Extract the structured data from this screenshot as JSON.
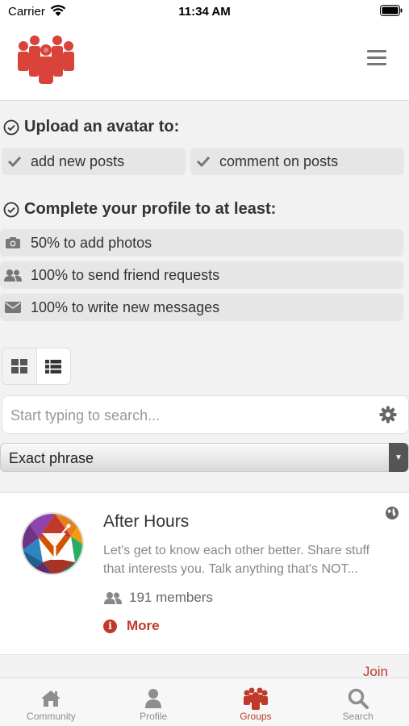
{
  "status_bar": {
    "carrier": "Carrier",
    "time": "11:34 AM"
  },
  "requirements": {
    "avatar_title": "Upload an avatar to:",
    "avatar_items": [
      {
        "label": "add new posts",
        "icon": "check-icon"
      },
      {
        "label": "comment on posts",
        "icon": "check-icon"
      }
    ],
    "profile_title": "Complete your profile to at least:",
    "profile_items": [
      {
        "label": "50% to add photos",
        "icon": "camera-icon"
      },
      {
        "label": "100% to send friend requests",
        "icon": "users-icon"
      },
      {
        "label": "100% to write new messages",
        "icon": "envelope-icon"
      }
    ]
  },
  "search": {
    "placeholder": "Start typing to search...",
    "value": ""
  },
  "match_mode": {
    "selected": "Exact phrase"
  },
  "group": {
    "name": "After Hours",
    "description_line1": "Let's get to know each other better. Share stuff",
    "description_line2": "that interests you. Talk anything that's NOT...",
    "members": "191 members",
    "more_label": "More",
    "join_label": "Join"
  },
  "tabs": [
    {
      "label": "Community",
      "icon": "home-icon"
    },
    {
      "label": "Profile",
      "icon": "user-icon"
    },
    {
      "label": "Groups",
      "icon": "groups-icon",
      "active": true
    },
    {
      "label": "Search",
      "icon": "magnifier-icon"
    }
  ],
  "colors": {
    "accent": "#c0392b",
    "logo": "#d9433a",
    "text_muted": "#888888",
    "background": "#f2f2f2"
  }
}
